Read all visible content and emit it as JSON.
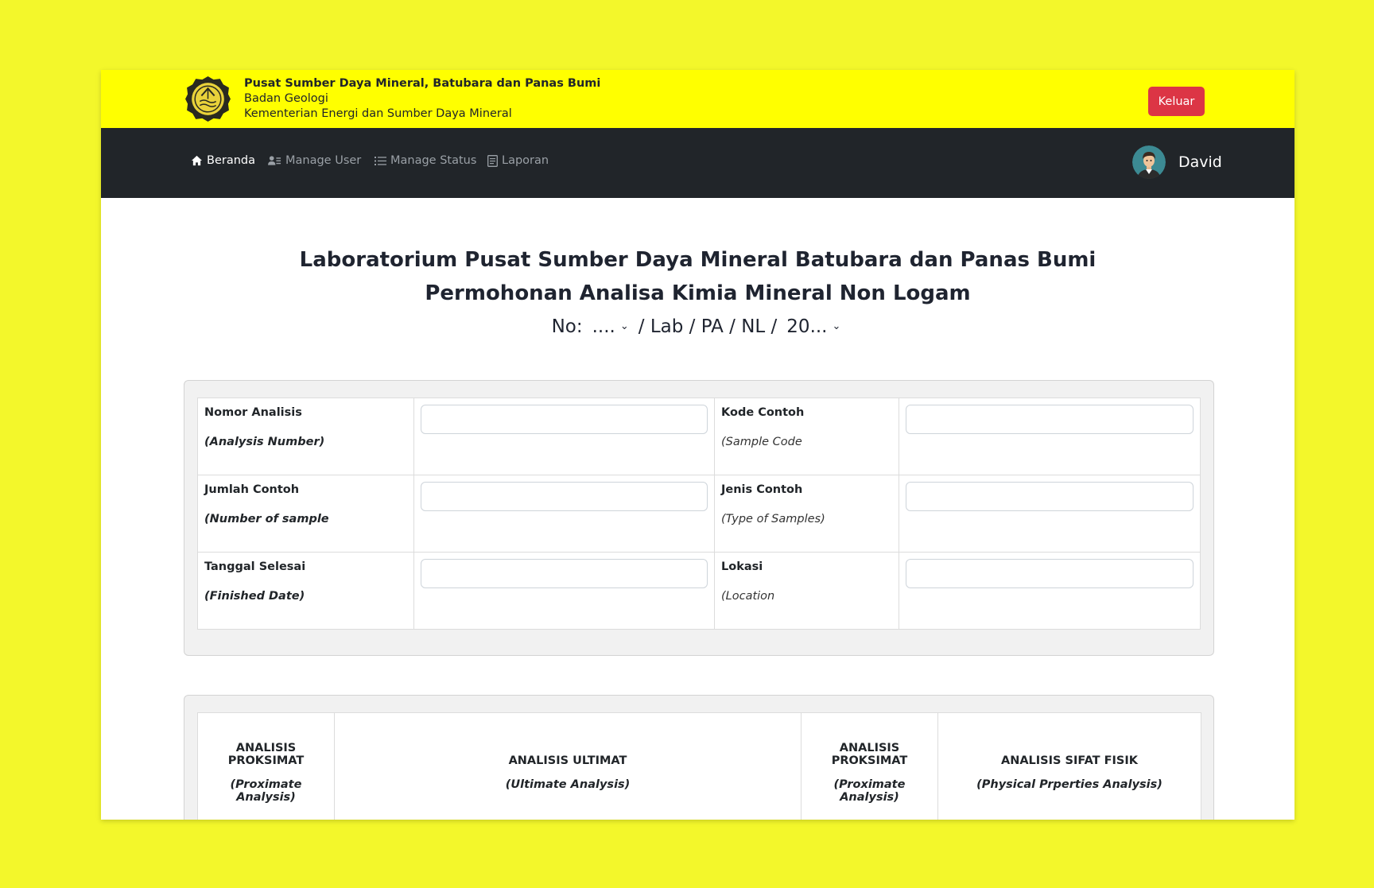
{
  "header": {
    "org_name": "Pusat Sumber Daya Mineral, Batubara dan Panas Bumi",
    "agency": "Badan Geologi",
    "ministry": "Kementerian Energi dan Sumber Daya Mineral",
    "logout_label": "Keluar"
  },
  "nav": {
    "items": [
      {
        "label": "Beranda",
        "icon": "home-icon",
        "active": true
      },
      {
        "label": "Manage User",
        "icon": "user-list-icon",
        "active": false
      },
      {
        "label": "Manage Status",
        "icon": "list-icon",
        "active": false
      },
      {
        "label": "Laporan",
        "icon": "report-icon",
        "active": false
      }
    ],
    "user_name": "David"
  },
  "page": {
    "title_line1": "Laboratorium Pusat Sumber Daya Mineral Batubara dan Panas Bumi",
    "title_line2": "Permohonan Analisa Kimia Mineral Non Logam",
    "number_prefix": "No:",
    "number_select": "....",
    "number_middle": "/ Lab / PA / NL /",
    "year_select": "20..."
  },
  "form": {
    "rows": [
      {
        "left_label": "Nomor Analisis",
        "left_sub": "(Analysis Number)",
        "left_value": "",
        "right_label": "Kode Contoh",
        "right_sub": "(Sample Code",
        "right_value": ""
      },
      {
        "left_label": "Jumlah Contoh",
        "left_sub": "(Number of sample",
        "left_value": "",
        "right_label": "Jenis Contoh",
        "right_sub": "(Type of Samples)",
        "right_value": ""
      },
      {
        "left_label": "Tanggal Selesai",
        "left_sub": "(Finished Date)",
        "left_value": "",
        "right_label": "Lokasi",
        "right_sub": "(Location",
        "right_value": ""
      }
    ]
  },
  "analysis": {
    "headers": [
      {
        "title": "ANALISIS PROKSIMAT",
        "sub": "(Proximate Analysis)"
      },
      {
        "title": "ANALISIS ULTIMAT",
        "sub": "(Ultimate Analysis)"
      },
      {
        "title": "ANALISIS PROKSIMAT",
        "sub": "(Proximate Analysis)"
      },
      {
        "title": "ANALISIS SIFAT FISIK",
        "sub": "(Physical Prperties Analysis)"
      }
    ]
  },
  "colors": {
    "background": "#f3f72b",
    "header_bg": "#ffff00",
    "navbar_bg": "#212529",
    "logout_bg": "#dc3545"
  }
}
